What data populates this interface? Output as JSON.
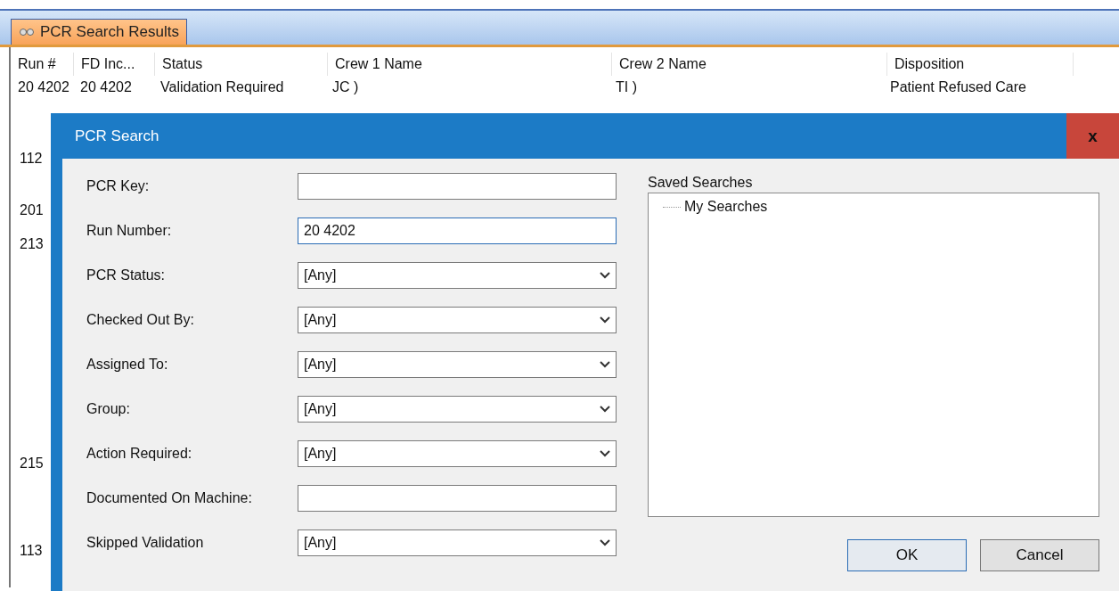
{
  "tabs": [
    {
      "label": "PCR Search Results",
      "selected": true
    }
  ],
  "table": {
    "columns": [
      "Run #",
      "FD Inc...",
      "Status",
      "Crew 1 Name",
      "Crew 2 Name",
      "Disposition"
    ],
    "rows": [
      [
        "20 4202",
        "20 4202",
        "Validation Required",
        "JC )",
        "TI )",
        "Patient Refused Care"
      ]
    ],
    "partial_rows": [
      "112",
      "201",
      "213",
      "215",
      "113"
    ]
  },
  "dialog": {
    "title": "PCR Search",
    "close": "x",
    "fields": [
      {
        "label": "PCR Key:",
        "kind": "text"
      },
      {
        "label": "Run Number:",
        "kind": "text",
        "value": "20 4202",
        "focused": true
      },
      {
        "label": "PCR Status:",
        "kind": "combo",
        "value": "[Any]"
      },
      {
        "label": "Checked Out By:",
        "kind": "combo",
        "value": "[Any]"
      },
      {
        "label": "Assigned To:",
        "kind": "combo",
        "value": "[Any]"
      },
      {
        "label": "Group:",
        "kind": "combo",
        "value": "[Any]"
      },
      {
        "label": "Action Required:",
        "kind": "combo",
        "value": "[Any]"
      },
      {
        "label": "Documented On Machine:",
        "kind": "text"
      },
      {
        "label": "Skipped Validation",
        "kind": "combo",
        "value": "[Any]"
      }
    ],
    "saved_searches": {
      "label": "Saved Searches",
      "tree": [
        {
          "label": "My Searches"
        }
      ]
    },
    "buttons": [
      {
        "label": "OK",
        "default": true
      },
      {
        "label": "Cancel",
        "default": false
      }
    ]
  }
}
